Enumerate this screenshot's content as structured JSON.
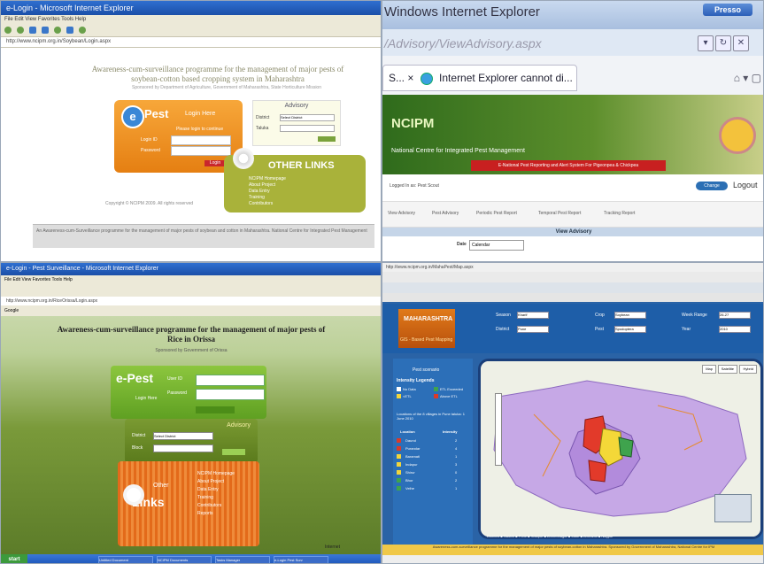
{
  "p1": {
    "titlebar": "e-Login - Microsoft Internet Explorer",
    "menu": "File  Edit  View  Favorites  Tools  Help",
    "address": "http://www.ncipm.org.in/Soybean/Login.aspx",
    "heading_line1": "Awareness-cum-surveillance programme for the management of major pests of",
    "heading_line2": "soybean-cotton based cropping system in Maharashtra",
    "subheading": "Sponsored by Department of Agriculture, Government of Maharashtra, State Horticulture Mission",
    "login": {
      "logo_letter": "e",
      "logo_text": "Pest",
      "logo_sub": "Login Here",
      "please": "Please login to continue",
      "user_label": "Login ID",
      "password_label": "Password",
      "login_button": "Login"
    },
    "advisory": {
      "title": "Advisory",
      "district_label": "District",
      "district_value": "Select District",
      "taluka_label": "Taluka",
      "go": "Go"
    },
    "other_links": {
      "title": "OTHER LINKS",
      "items": [
        "NCIPM Homepage",
        "About Project",
        "Data Entry",
        "Training",
        "Contributors"
      ]
    },
    "copyright": "Copyright © NCIPM 2009. All rights reserved",
    "footer": "An Awareness-cum-Surveillance programme for the management of major pests of soybean and cotton in Maharashtra. National Centre for Integrated Pest Management"
  },
  "p2": {
    "window_title": "Windows Internet Explorer",
    "presso": "Presso",
    "address": "/Advisory/ViewAdvisory.aspx",
    "tab_prefix": "S... ×",
    "tab_label": "Internet Explorer cannot di...",
    "banner_name": "NCIPM",
    "banner_full": "National Centre for Integrated Pest Management",
    "banner_red": "E-National Pest Reporting and Alert System For Pigeonpea & Chickpea",
    "user": "Logged In as: Pest Scout",
    "change_password": "Change Password",
    "logout": "Logout",
    "nav": [
      "View Advisory",
      "Pest Advisory",
      "Periodic Pest Report",
      "Temporal Pest Report",
      "Tracking Report"
    ],
    "view_advisory": "View Advisory",
    "date_label": "Date",
    "date_value": "Calendar"
  },
  "p3": {
    "titlebar": "e-Login - Pest Surveillance - Microsoft Internet Explorer",
    "menu": "File  Edit  View  Favorites  Tools  Help",
    "address": "http://www.ncipm.org.in/RiceOrissa/Login.aspx",
    "google": "Google",
    "heading_line1": "Awareness-cum-surveillance programme for the management of major pests of",
    "heading_line2": "Rice in Orissa",
    "subheading": "Sponsored by Government of Orissa",
    "login": {
      "title": "e-Pest",
      "sub": "Login Here",
      "user_label": "User ID",
      "password_label": "Password",
      "button": "Login"
    },
    "advisory": {
      "title": "Advisory",
      "label1": "District",
      "label2": "Block",
      "value1": "Select District",
      "go": "Go"
    },
    "links": {
      "title": "Links",
      "sub": "Other",
      "items": [
        "NCIPM Homepage",
        "About Project",
        "Data Entry",
        "Training",
        "Contributors",
        "Reports"
      ]
    },
    "internet": "Internet",
    "start": "start",
    "tasks": [
      "Untitled Document",
      "NCIPM Documents",
      "Tasks Manager",
      "e-Login Pest Surv"
    ]
  },
  "p4": {
    "address": "http://www.ncipm.org.in/MahaPest/Map.aspx",
    "header_title": "MAHARASHTRA",
    "header_sub": "GIS - Based Pest Mapping",
    "fields": [
      {
        "label": "Season",
        "value": "Kharif"
      },
      {
        "label": "Crop",
        "value": "Soybean"
      },
      {
        "label": "Week Range",
        "value": "26-27"
      },
      {
        "label": "District",
        "value": "Pune"
      },
      {
        "label": "Pest",
        "value": "Spodoptera"
      },
      {
        "label": "Year",
        "value": "2010"
      }
    ],
    "pest_scenario": "Pest scenario",
    "intensity": "Intensity Legends",
    "legend_items": [
      "No Data",
      "ETL Exceeded",
      "<ETL",
      "Above ETL"
    ],
    "location_text": "Locations of the 8 villages in Pune taluka: 1 June 2010",
    "loc_header": [
      "Location",
      "Intensity"
    ],
    "locations": [
      {
        "name": "Daund",
        "value": "2"
      },
      {
        "name": "Purandar",
        "value": "4"
      },
      {
        "name": "Baramati",
        "value": "1"
      },
      {
        "name": "Indapur",
        "value": "3"
      },
      {
        "name": "Shirur",
        "value": "0"
      },
      {
        "name": "Bhor",
        "value": "2"
      },
      {
        "name": "Velhe",
        "value": "1"
      }
    ],
    "map_buttons": [
      "Map",
      "Satellite",
      "Hybrid"
    ],
    "bottom_legend": "Districts  ■ Nashik  ■ Pune  ■ Solapur  ■ Ahmednagar  ■ Latur  ■ Amravati  ■ Nagpur",
    "footer": "Awareness-cum-surveillance programme for the management of major pests of soybean-cotton in Maharashtra. Sponsored by Government of Maharashtra, National Centre for IPM"
  },
  "colors": {
    "orange": "#f39a2a",
    "olive": "#a9b23a",
    "ncipm_green": "#3a7a22",
    "map_purple": "#b79ad9",
    "blue": "#2a63a6"
  }
}
